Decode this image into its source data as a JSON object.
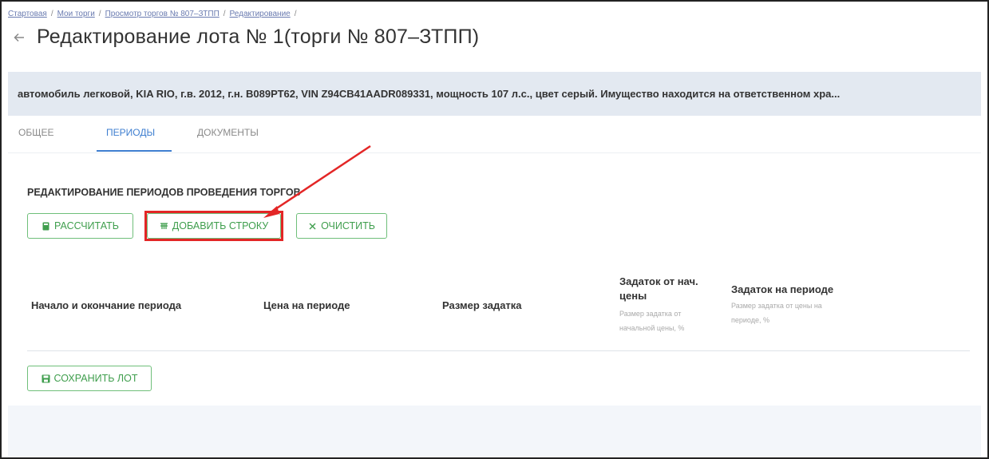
{
  "breadcrumb": {
    "items": [
      "Стартовая",
      "Мои торги",
      "Просмотр торгов № 807–ЗТПП",
      "Редактирование"
    ],
    "separator": "/"
  },
  "page": {
    "back_icon": "arrow-left-icon",
    "title": "Редактирование лота № 1(торги № 807–ЗТПП)"
  },
  "lot": {
    "description": "автомобиль легковой, KIA RIO, г.в. 2012, г.н. В089РТ62, VIN Z94CB41AADR089331, мощность 107 л.с., цвет серый. Имущество находится на ответственном хра..."
  },
  "tabs": [
    {
      "label": "Общее",
      "active": false
    },
    {
      "label": "Периоды",
      "active": true
    },
    {
      "label": "Документы",
      "active": false
    }
  ],
  "section": {
    "title": "РЕДАКТИРОВАНИЕ ПЕРИОДОВ ПРОВЕДЕНИЯ ТОРГОВ"
  },
  "toolbar": {
    "calculate_label": "РАССЧИТАТЬ",
    "calculate_icon": "calculator-icon",
    "add_row_label": "ДОБАВИТЬ СТРОКУ",
    "add_row_icon": "add-row-icon",
    "clear_label": "ОЧИСТИТЬ",
    "clear_icon": "close-icon"
  },
  "table": {
    "columns": [
      {
        "title": "Начало и окончание периода",
        "subtitle": ""
      },
      {
        "title": "Цена на периоде",
        "subtitle": ""
      },
      {
        "title": "Размер задатка",
        "subtitle": ""
      },
      {
        "title": "Задаток от нач. цены",
        "subtitle": "Размер задатка от начальной цены, %"
      },
      {
        "title": "Задаток на периоде",
        "subtitle": "Размер задатка от цены на периоде, %"
      }
    ],
    "rows": []
  },
  "footer": {
    "save_label": "СОХРАНИТЬ ЛОТ",
    "save_icon": "save-icon"
  },
  "colors": {
    "accent": "#3f7fd0",
    "button_green": "#3f9e4d",
    "highlight_red": "#e32626",
    "banner_bg": "#e3e9f1"
  }
}
